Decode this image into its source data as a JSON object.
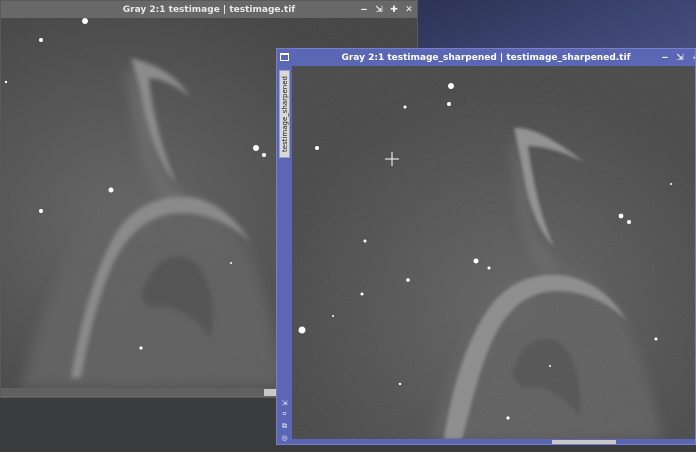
{
  "windows": [
    {
      "id": "testimage",
      "title": "Gray 2:1 testimage | testimage.tif",
      "active": false,
      "controls": [
        "‒",
        "⇲",
        "✚",
        "✕"
      ]
    },
    {
      "id": "testimage_sharpened",
      "title": "Gray 2:1 testimage_sharpened | testimage_sharpened.tif",
      "active": true,
      "controls": [
        "‒",
        "⇲",
        "◂"
      ],
      "side_tab_label": "testimage_sharpened",
      "side_icons": [
        "⇲",
        "⌗",
        "⧉",
        "◎"
      ]
    }
  ],
  "colors": {
    "active_title": "#5b67b4",
    "inactive_title": "#686868",
    "desktop": "#3a3c3e"
  }
}
